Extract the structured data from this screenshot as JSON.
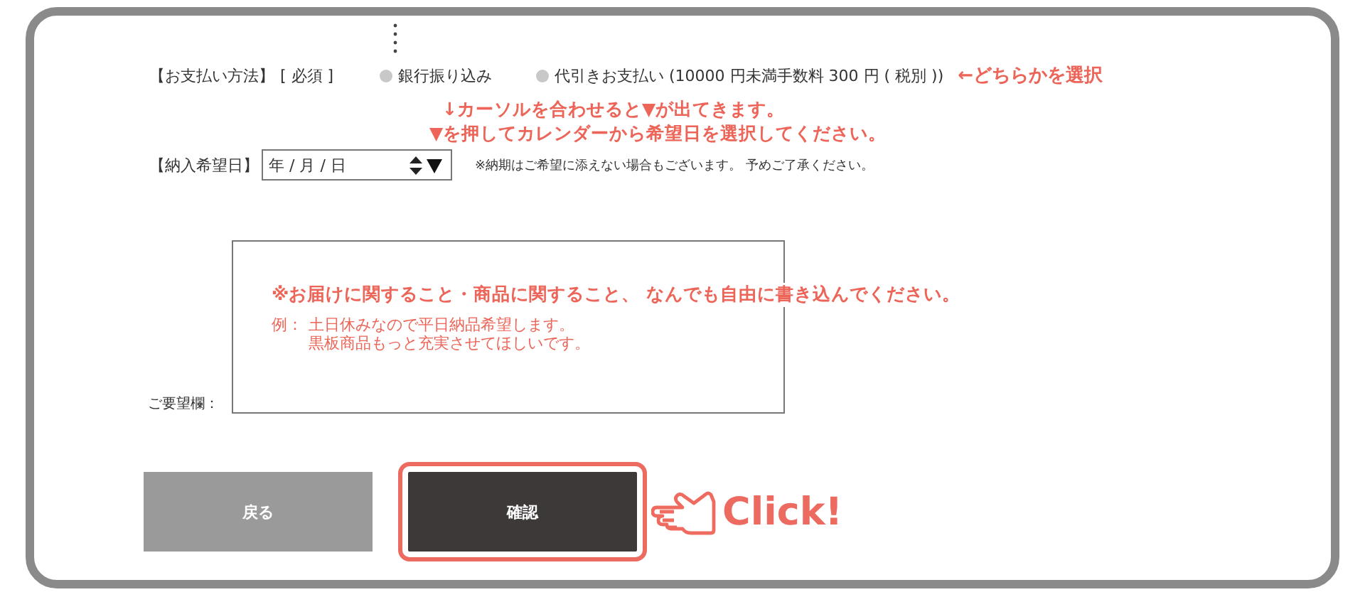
{
  "payment": {
    "label": "【お支払い方法】",
    "required": "[ 必須 ]",
    "options": [
      {
        "label": "銀行振り込み",
        "selected": false
      },
      {
        "label": "代引きお支払い (10000 円未満手数料 300 円 ( 税別 ))",
        "selected": false
      }
    ],
    "hint": "←どちらかを選択"
  },
  "delivery": {
    "instructions": [
      "↓カーソルを合わせると▼が出てきます。",
      "▼を押してカレンダーから希望日を選択してください。"
    ],
    "label": "【納入希望日】",
    "placeholder": "年 / 月 / 日",
    "note": "※納期はご希望に添えない場合もございます。 予めご了承ください。"
  },
  "requests": {
    "label": "ご要望欄：",
    "guide": "※お届けに関すること・商品に関すること、 なんでも自由に書き込んでください。",
    "example_label": "例：",
    "example_lines": [
      "土日休みなので平日納品希望します。",
      "黒板商品もっと充実させてほしいです。"
    ]
  },
  "buttons": [
    {
      "label": "戻る",
      "kind": "back",
      "highlighted": false
    },
    {
      "label": "確認",
      "kind": "confirm",
      "highlighted": true
    }
  ],
  "callout": "Click!"
}
